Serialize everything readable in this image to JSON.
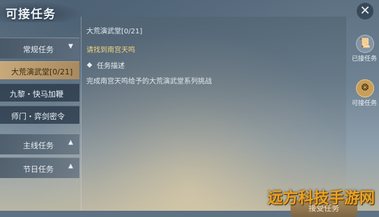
{
  "window": {
    "title": "可接任务"
  },
  "sidebar": {
    "categories": [
      {
        "label": "常规任务",
        "chevron": "▼"
      },
      {
        "label": "主线任务",
        "chevron": "▲"
      },
      {
        "label": "节日任务",
        "chevron": "▲"
      }
    ],
    "items": [
      {
        "label": "大荒演武堂[0/21]"
      },
      {
        "label": "九黎・快马加鞭"
      },
      {
        "label": "师门・弈剑密令"
      }
    ]
  },
  "quest": {
    "name": "大荒演武堂[0/21]",
    "goal": "请找到南宫天鸣",
    "desc_header": "任务描述",
    "desc_text": "完成南宫天鸣给予的大荒演武堂系列挑战",
    "accept_label": "接受任务"
  },
  "rightbar": {
    "accepted_label": "已接任务",
    "available_label": "可接任务"
  },
  "watermark": "远方科技手游网",
  "close_glyph": "✕"
}
